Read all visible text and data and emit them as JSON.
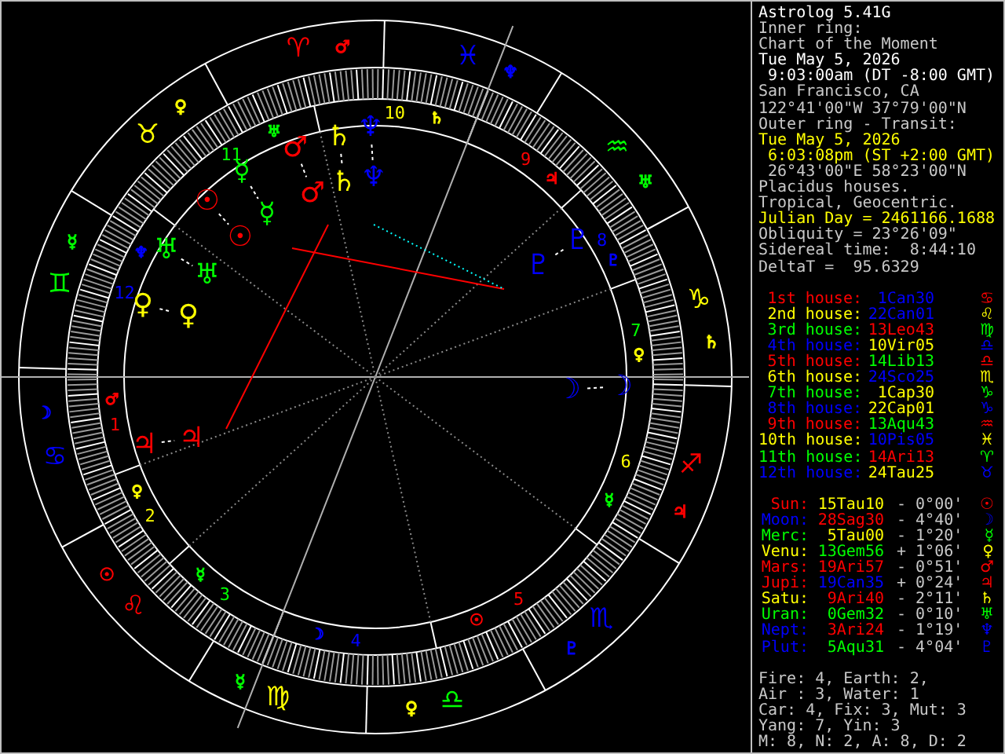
{
  "info": [
    {
      "text": "Astrolog 5.41G",
      "color": "#ffffff"
    },
    {
      "text": "Inner ring:",
      "color": "#c8c8c8"
    },
    {
      "text": "Chart of the Moment",
      "color": "#c8c8c8"
    },
    {
      "text": "Tue May 5, 2026",
      "color": "#ffffff"
    },
    {
      "text": " 9:03:00am (DT -8:00 GMT)",
      "color": "#ffffff"
    },
    {
      "text": "San Francisco, CA",
      "color": "#c8c8c8"
    },
    {
      "text": "122°41'00\"W 37°79'00\"N",
      "color": "#c8c8c8"
    },
    {
      "text": "Outer ring - Transit:",
      "color": "#c8c8c8"
    },
    {
      "text": "Tue May 5, 2026",
      "color": "#ffff00"
    },
    {
      "text": " 6:03:08pm (ST +2:00 GMT)",
      "color": "#ffff00"
    },
    {
      "text": " 26°43'00\"E 58°23'00\"N",
      "color": "#c8c8c8"
    },
    {
      "text": "Placidus houses.",
      "color": "#c8c8c8"
    },
    {
      "text": "Tropical, Geocentric.",
      "color": "#c8c8c8"
    },
    {
      "text": "Julian Day = 2461166.1688",
      "color": "#ffff00"
    },
    {
      "text": "Obliquity = 23°26'09\"",
      "color": "#c8c8c8"
    },
    {
      "text": "Sidereal time:  8:44:10",
      "color": "#c8c8c8"
    },
    {
      "text": "DeltaT =  95.6329",
      "color": "#c8c8c8"
    }
  ],
  "houses": [
    {
      "label": "1st house:",
      "color": "#ff0000",
      "cusp": {
        "text": "1Can30",
        "color": "#0000ff"
      },
      "glyph": "♋"
    },
    {
      "label": "2nd house:",
      "color": "#ffff00",
      "cusp": {
        "text": "22Can01",
        "color": "#0000ff"
      },
      "glyph": "♌"
    },
    {
      "label": "3rd house:",
      "color": "#00ff00",
      "cusp": {
        "text": "13Leo43",
        "color": "#ff0000"
      },
      "glyph": "♍"
    },
    {
      "label": "4th house:",
      "color": "#0000ff",
      "cusp": {
        "text": "10Vir05",
        "color": "#ffff00"
      },
      "glyph": "♎"
    },
    {
      "label": "5th house:",
      "color": "#ff0000",
      "cusp": {
        "text": "14Lib13",
        "color": "#00ff00"
      },
      "glyph": "♎"
    },
    {
      "label": "6th house:",
      "color": "#ffff00",
      "cusp": {
        "text": "24Sco25",
        "color": "#0000ff"
      },
      "glyph": "♏"
    },
    {
      "label": "7th house:",
      "color": "#00ff00",
      "cusp": {
        "text": "1Cap30",
        "color": "#ffff00"
      },
      "glyph": "♑"
    },
    {
      "label": "8th house:",
      "color": "#0000ff",
      "cusp": {
        "text": "22Cap01",
        "color": "#ffff00"
      },
      "glyph": "♑"
    },
    {
      "label": "9th house:",
      "color": "#ff0000",
      "cusp": {
        "text": "13Aqu43",
        "color": "#00ff00"
      },
      "glyph": "♒"
    },
    {
      "label": "10th house:",
      "color": "#ffff00",
      "cusp": {
        "text": "10Pis05",
        "color": "#0000ff"
      },
      "glyph": "♓"
    },
    {
      "label": "11th house:",
      "color": "#00ff00",
      "cusp": {
        "text": "14Ari13",
        "color": "#ff0000"
      },
      "glyph": "♈"
    },
    {
      "label": "12th house:",
      "color": "#0000ff",
      "cusp": {
        "text": "24Tau25",
        "color": "#ffff00"
      },
      "glyph": "♉"
    }
  ],
  "planets": [
    {
      "name": "Sun:",
      "color": "#ff0000",
      "position": {
        "text": "15Tau10",
        "color": "#ffff00"
      },
      "speed": "- 0°00'",
      "glyph": "☉"
    },
    {
      "name": "Moon:",
      "color": "#0000ff",
      "position": {
        "text": "28Sag30",
        "color": "#ff0000"
      },
      "speed": "- 4°40'",
      "glyph": "☽"
    },
    {
      "name": "Merc:",
      "color": "#00ff00",
      "position": {
        "text": "5Tau00",
        "color": "#ffff00"
      },
      "speed": "- 1°20'",
      "glyph": "☿"
    },
    {
      "name": "Venu:",
      "color": "#ffff00",
      "position": {
        "text": "13Gem56",
        "color": "#00ff00"
      },
      "speed": "+ 1°06'",
      "glyph": "♀"
    },
    {
      "name": "Mars:",
      "color": "#ff0000",
      "position": {
        "text": "19Ari57",
        "color": "#ff0000"
      },
      "speed": "- 0°51'",
      "glyph": "♂"
    },
    {
      "name": "Jupi:",
      "color": "#ff0000",
      "position": {
        "text": "19Can35",
        "color": "#0000ff"
      },
      "speed": "+ 0°24'",
      "glyph": "♃"
    },
    {
      "name": "Satu:",
      "color": "#ffff00",
      "position": {
        "text": "9Ari40",
        "color": "#ff0000"
      },
      "speed": "- 2°11'",
      "glyph": "♄"
    },
    {
      "name": "Uran:",
      "color": "#00ff00",
      "position": {
        "text": "0Gem32",
        "color": "#00ff00"
      },
      "speed": "- 0°10'",
      "glyph": "♅"
    },
    {
      "name": "Nept:",
      "color": "#0000ff",
      "position": {
        "text": "3Ari24",
        "color": "#ff0000"
      },
      "speed": "- 1°19'",
      "glyph": "♆"
    },
    {
      "name": "Plut:",
      "color": "#0000ff",
      "position": {
        "text": "5Aqu31",
        "color": "#00ff00"
      },
      "speed": "- 4°04'",
      "glyph": "♇"
    }
  ],
  "elements": [
    "Fire: 4, Earth: 2,",
    "Air : 3, Water: 1",
    "Car: 4, Fix: 3, Mut: 3",
    "Yang: 7, Yin: 3",
    "M: 8, N: 2, A: 8, D: 2"
  ],
  "wheel": {
    "signs": [
      {
        "glyph": "♈",
        "color": "#ff0000",
        "ruler": {
          "glyph": "♂",
          "color": "#ff0000"
        }
      },
      {
        "glyph": "♉",
        "color": "#ffff00",
        "ruler": {
          "glyph": "♀",
          "color": "#ffff00"
        }
      },
      {
        "glyph": "♊",
        "color": "#00ff00",
        "ruler": {
          "glyph": "☿",
          "color": "#00ff00"
        }
      },
      {
        "glyph": "♋",
        "color": "#0000ff",
        "ruler": {
          "glyph": "☽",
          "color": "#0000ff"
        }
      },
      {
        "glyph": "♌",
        "color": "#ff0000",
        "ruler": {
          "glyph": "☉",
          "color": "#ff0000"
        }
      },
      {
        "glyph": "♍",
        "color": "#ffff00",
        "ruler": {
          "glyph": "☿",
          "color": "#00ff00"
        }
      },
      {
        "glyph": "♎",
        "color": "#00ff00",
        "ruler": {
          "glyph": "♀",
          "color": "#ffff00"
        }
      },
      {
        "glyph": "♏",
        "color": "#0000ff",
        "ruler": {
          "glyph": "♇",
          "color": "#0000ff"
        }
      },
      {
        "glyph": "♐",
        "color": "#ff0000",
        "ruler": {
          "glyph": "♃",
          "color": "#ff0000"
        }
      },
      {
        "glyph": "♑",
        "color": "#ffff00",
        "ruler": {
          "glyph": "♄",
          "color": "#ffff00"
        }
      },
      {
        "glyph": "♒",
        "color": "#00ff00",
        "ruler": {
          "glyph": "♅",
          "color": "#00ff00"
        }
      },
      {
        "glyph": "♓",
        "color": "#0000ff",
        "ruler": {
          "glyph": "♆",
          "color": "#0000ff"
        }
      }
    ],
    "houses": [
      {
        "number": "1",
        "color": "#ff0000",
        "ruler": {
          "glyph": "♂",
          "color": "#ff0000"
        }
      },
      {
        "number": "2",
        "color": "#ffff00",
        "ruler": {
          "glyph": "♀",
          "color": "#ffff00"
        }
      },
      {
        "number": "3",
        "color": "#00ff00",
        "ruler": {
          "glyph": "☿",
          "color": "#00ff00"
        }
      },
      {
        "number": "4",
        "color": "#0000ff",
        "ruler": {
          "glyph": "☽",
          "color": "#0000ff"
        }
      },
      {
        "number": "5",
        "color": "#ff0000",
        "ruler": {
          "glyph": "☉",
          "color": "#ff0000"
        }
      },
      {
        "number": "6",
        "color": "#ffff00",
        "ruler": {
          "glyph": "☿",
          "color": "#00ff00"
        }
      },
      {
        "number": "7",
        "color": "#00ff00",
        "ruler": {
          "glyph": "♀",
          "color": "#ffff00"
        }
      },
      {
        "number": "8",
        "color": "#0000ff",
        "ruler": {
          "glyph": "♇",
          "color": "#0000ff"
        }
      },
      {
        "number": "9",
        "color": "#ff0000",
        "ruler": {
          "glyph": "♃",
          "color": "#ff0000"
        }
      },
      {
        "number": "10",
        "color": "#ffff00",
        "ruler": {
          "glyph": "♄",
          "color": "#ffff00"
        }
      },
      {
        "number": "11",
        "color": "#00ff00",
        "ruler": {
          "glyph": "♅",
          "color": "#00ff00"
        }
      },
      {
        "number": "12",
        "color": "#0000ff",
        "ruler": {
          "glyph": "♆",
          "color": "#0000ff"
        }
      }
    ],
    "natal": [
      {
        "glyph": "☉",
        "color": "#ff0000"
      },
      {
        "glyph": "☽",
        "color": "#0000ff"
      },
      {
        "glyph": "☿",
        "color": "#00ff00"
      },
      {
        "glyph": "♀",
        "color": "#ffff00"
      },
      {
        "glyph": "♂",
        "color": "#ff0000"
      },
      {
        "glyph": "♃",
        "color": "#ff0000"
      },
      {
        "glyph": "♄",
        "color": "#ffff00"
      },
      {
        "glyph": "♅",
        "color": "#00ff00"
      },
      {
        "glyph": "♆",
        "color": "#0000ff"
      },
      {
        "glyph": "♇",
        "color": "#0000ff"
      }
    ],
    "transit": [
      {
        "glyph": "☉",
        "color": "#ff0000"
      },
      {
        "glyph": "☽",
        "color": "#0000ff"
      },
      {
        "glyph": "☿",
        "color": "#00ff00"
      },
      {
        "glyph": "♀",
        "color": "#ffff00"
      },
      {
        "glyph": "♂",
        "color": "#ff0000"
      },
      {
        "glyph": "♃",
        "color": "#ff0000"
      },
      {
        "glyph": "♄",
        "color": "#ffff00"
      },
      {
        "glyph": "♅",
        "color": "#00ff00"
      },
      {
        "glyph": "♆",
        "color": "#0000ff"
      },
      {
        "glyph": "♇",
        "color": "#0000ff"
      }
    ]
  }
}
